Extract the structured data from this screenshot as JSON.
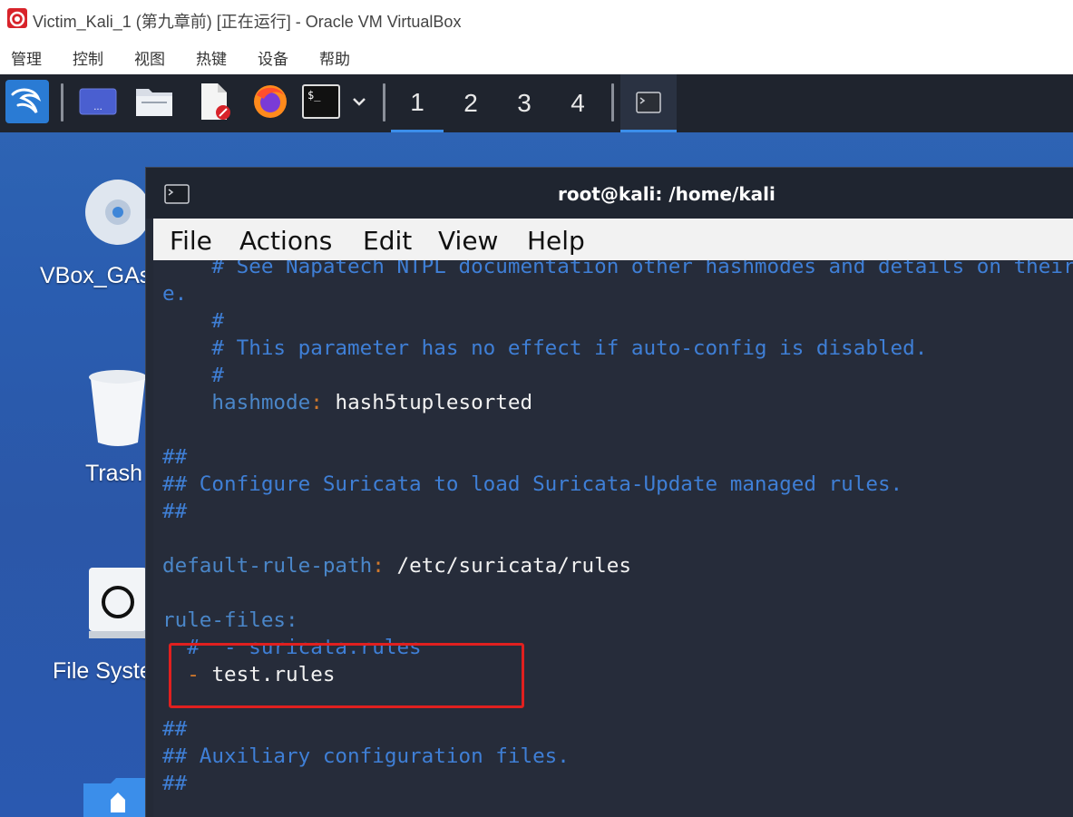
{
  "window": {
    "title": "Victim_Kali_1 (第九章前) [正在运行] - Oracle VM VirtualBox"
  },
  "menubar": [
    "管理",
    "控制",
    "视图",
    "热键",
    "设备",
    "帮助"
  ],
  "panel": {
    "workspaces": [
      "1",
      "2",
      "3",
      "4"
    ],
    "active_workspace": "1",
    "icons": [
      "kali-menu-icon",
      "show-desktop-icon",
      "file-manager-icon",
      "text-editor-icon",
      "firefox-icon",
      "terminal-icon",
      "terminal-dropdown-icon"
    ]
  },
  "desktop": {
    "icons": [
      {
        "label": "VBox_GAs_",
        "icon": "cd-icon"
      },
      {
        "label": "Trash",
        "icon": "trash-icon"
      },
      {
        "label": "File System",
        "icon": "drive-icon"
      },
      {
        "label": "",
        "icon": "home-folder-icon"
      }
    ]
  },
  "terminal": {
    "title": "root@kali: /home/kali",
    "menu": [
      "File",
      "Actions",
      "Edit",
      "View",
      "Help"
    ],
    "lines": [
      "    # See Napatech NTPL documentation other hashmodes and details on their us",
      "e.",
      "    #",
      "    # This parameter has no effect if auto-config is disabled.",
      "    #",
      "    hashmode: hash5tuplesorted",
      "",
      "##",
      "## Configure Suricata to load Suricata-Update managed rules.",
      "##",
      "",
      "default-rule-path: /etc/suricata/rules",
      "",
      "rule-files:",
      "  #  - suricata.rules",
      "  - test.rules",
      "",
      "##",
      "## Auxiliary configuration files.",
      "##"
    ],
    "hashmode_key": "hashmode",
    "hashmode_value": "hash5tuplesorted",
    "rule_path_key": "default-rule-path",
    "rule_path_value": "/etc/suricata/rules",
    "rule_files_key": "rule-files",
    "commented_rule": "suricata.rules",
    "active_rule": "test.rules"
  },
  "colors": {
    "terminal_bg": "#262c3a",
    "comment": "#3f7fd6",
    "highlight_box": "#e0201f",
    "panel_bg": "#1f242e",
    "desktop_bg": "#2a5db0"
  }
}
